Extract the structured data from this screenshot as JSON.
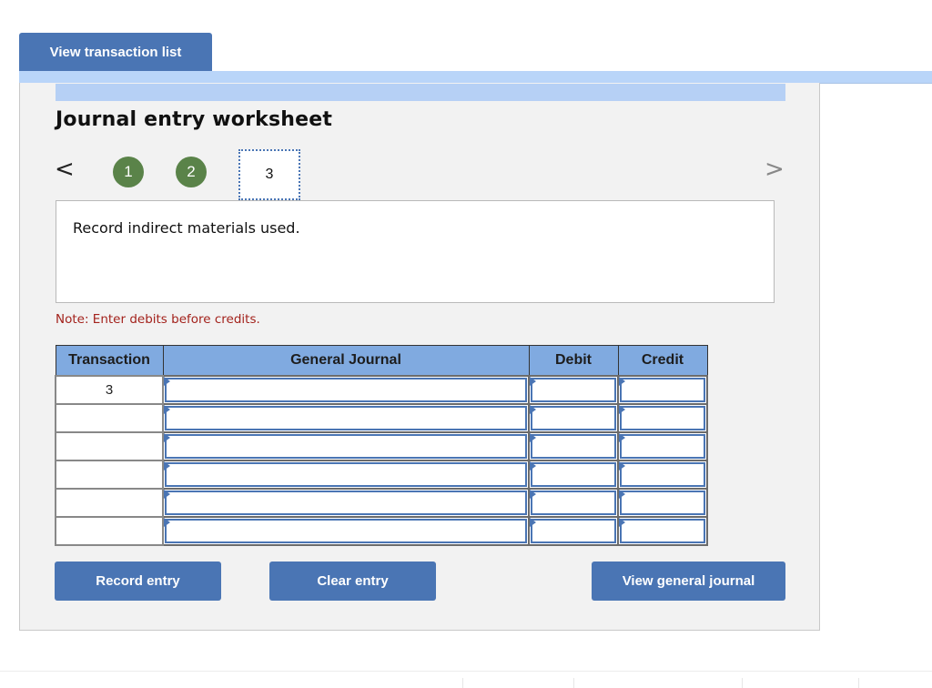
{
  "top_button": {
    "label": "View transaction list"
  },
  "worksheet": {
    "title": "Journal entry worksheet",
    "nav": {
      "prev_icon": "chevron-left-icon",
      "next_icon": "chevron-right-icon",
      "prev_glyph": "<",
      "next_glyph": ">",
      "steps": [
        {
          "label": "1",
          "status": "completed"
        },
        {
          "label": "2",
          "status": "completed"
        },
        {
          "label": "3",
          "status": "current"
        }
      ]
    },
    "description": "Record indirect materials used.",
    "note": "Note: Enter debits before credits.",
    "colors": {
      "button": "#4a75b4",
      "step_completed": "#5a8349",
      "table_header": "#80aae0",
      "note_text": "#a3221c",
      "band": "#b9d5f9"
    }
  },
  "table": {
    "headers": [
      "Transaction",
      "General Journal",
      "Debit",
      "Credit"
    ],
    "rows": [
      {
        "transaction": "3",
        "general_journal": "",
        "debit": "",
        "credit": ""
      },
      {
        "transaction": "",
        "general_journal": "",
        "debit": "",
        "credit": ""
      },
      {
        "transaction": "",
        "general_journal": "",
        "debit": "",
        "credit": ""
      },
      {
        "transaction": "",
        "general_journal": "",
        "debit": "",
        "credit": ""
      },
      {
        "transaction": "",
        "general_journal": "",
        "debit": "",
        "credit": ""
      },
      {
        "transaction": "",
        "general_journal": "",
        "debit": "",
        "credit": ""
      }
    ]
  },
  "actions": {
    "record_entry": "Record entry",
    "clear_entry": "Clear entry",
    "view_general_journal": "View general journal"
  }
}
